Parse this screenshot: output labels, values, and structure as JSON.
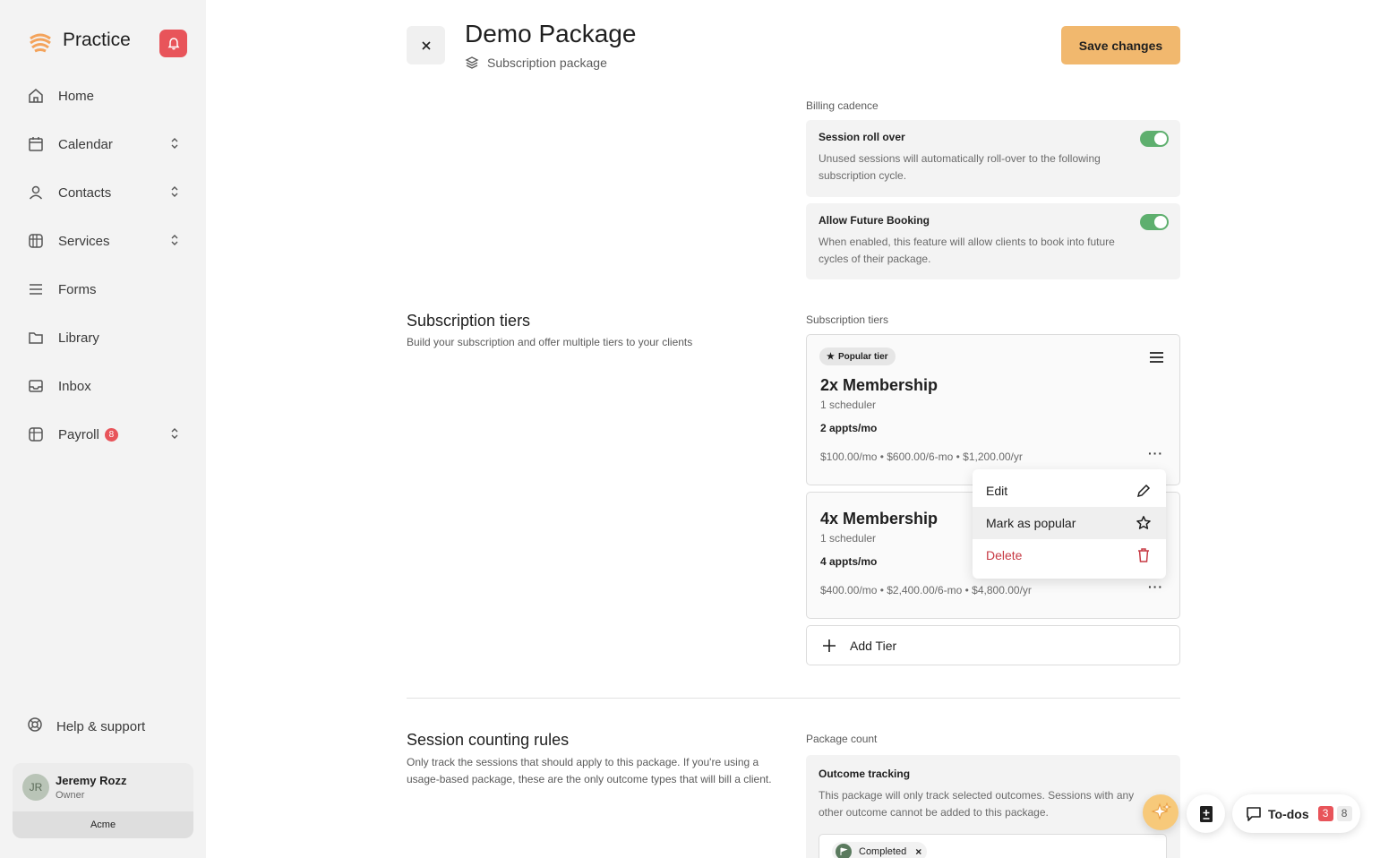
{
  "app": {
    "name": "Practice"
  },
  "sidebar": {
    "items": [
      {
        "label": "Home",
        "icon": "home-icon",
        "expandable": false
      },
      {
        "label": "Calendar",
        "icon": "calendar-icon",
        "expandable": true
      },
      {
        "label": "Contacts",
        "icon": "user-icon",
        "expandable": true
      },
      {
        "label": "Services",
        "icon": "services-icon",
        "expandable": true
      },
      {
        "label": "Forms",
        "icon": "list-icon",
        "expandable": false
      },
      {
        "label": "Library",
        "icon": "folder-icon",
        "expandable": false
      },
      {
        "label": "Inbox",
        "icon": "inbox-icon",
        "expandable": false
      },
      {
        "label": "Payroll",
        "icon": "payroll-icon",
        "expandable": true,
        "badge": "8"
      }
    ],
    "help_label": "Help & support",
    "user": {
      "initials": "JR",
      "name": "Jeremy Rozz",
      "role": "Owner",
      "org": "Acme"
    }
  },
  "header": {
    "title": "Demo Package",
    "subtitle": "Subscription package",
    "save_label": "Save changes"
  },
  "billing": {
    "label": "Billing cadence",
    "options": [
      {
        "title": "Session roll over",
        "desc": "Unused sessions will automatically roll-over to the following subscription cycle.",
        "enabled": true
      },
      {
        "title": "Allow Future Booking",
        "desc": "When enabled, this feature will allow clients to book into future cycles of their package.",
        "enabled": true
      }
    ]
  },
  "tiers_section": {
    "title": "Subscription tiers",
    "desc": "Build your subscription and offer multiple tiers to your clients",
    "field_label": "Subscription tiers",
    "tiers": [
      {
        "badge": "Popular tier",
        "name": "2x Membership",
        "schedulers": "1 scheduler",
        "appts": "2 appts/mo",
        "price": "$100.00/mo • $600.00/6-mo • $1,200.00/yr"
      },
      {
        "name": "4x Membership",
        "schedulers": "1 scheduler",
        "appts": "4 appts/mo",
        "price": "$400.00/mo • $2,400.00/6-mo • $4,800.00/yr"
      }
    ],
    "add_label": "Add Tier",
    "menu": {
      "edit": "Edit",
      "popular": "Mark as popular",
      "delete": "Delete"
    }
  },
  "counting": {
    "title": "Session counting rules",
    "desc": "Only track the sessions that should apply to this package. If you're using a usage-based package, these are the only outcome types that will bill a client.",
    "field_label": "Package count",
    "card_title": "Outcome tracking",
    "card_desc": "This package will only track selected outcomes. Sessions with any other outcome cannot be added to this package.",
    "chip": "Completed"
  },
  "floating": {
    "todos_label": "To-dos",
    "todos_count_a": "3",
    "todos_count_b": "8"
  },
  "colors": {
    "accent": "#f1b86e",
    "toggle_on": "#5eaf6e",
    "danger": "#c73a44",
    "bell": "#e8545a"
  }
}
